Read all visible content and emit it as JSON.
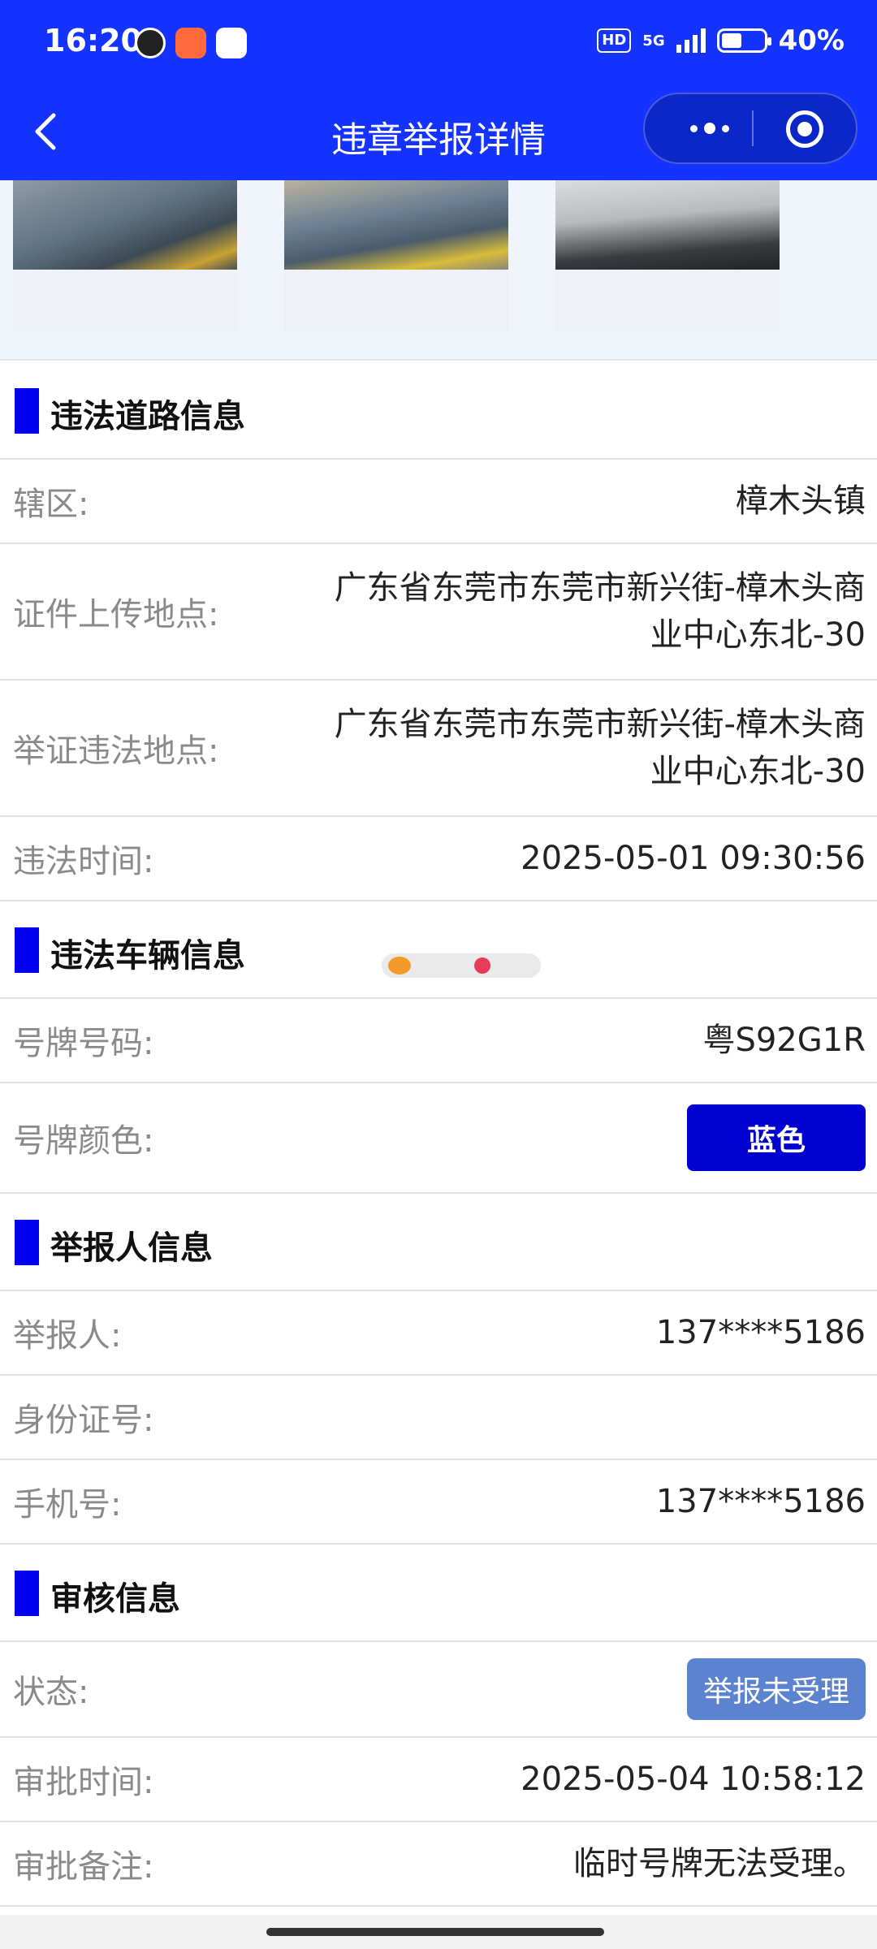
{
  "status_bar": {
    "time": "16:20",
    "hd": "HD",
    "network": "5G",
    "battery": "40%",
    "battery_level": 0.4
  },
  "navbar": {
    "title": "违章举报详情",
    "back_icon": "chevron-left-icon",
    "more_icon": "more-dots-icon",
    "target_icon": "target-icon"
  },
  "sections": {
    "road": {
      "title": "违法道路信息",
      "rows": {
        "district": {
          "label": "辖区:",
          "value": "樟木头镇"
        },
        "upload_location": {
          "label": "证件上传地点:",
          "value_line1": "广东省东莞市东莞市新兴街-樟木头商",
          "value_line2": "业中心东北-30"
        },
        "violation_location": {
          "label": "举证违法地点:",
          "value_line1": "广东省东莞市东莞市新兴街-樟木头商",
          "value_line2": "业中心东北-30"
        },
        "violation_time": {
          "label": "违法时间:",
          "value": "2025-05-01 09:30:56"
        }
      }
    },
    "vehicle": {
      "title": "违法车辆信息",
      "rows": {
        "plate_number": {
          "label": "号牌号码:",
          "value": "粤S92G1R"
        },
        "plate_color": {
          "label": "号牌颜色:",
          "value": "蓝色"
        }
      }
    },
    "reporter": {
      "title": "举报人信息",
      "rows": {
        "reporter": {
          "label": "举报人:",
          "value": "137****5186"
        },
        "id_number": {
          "label": "身份证号:",
          "value": ""
        },
        "phone": {
          "label": "手机号:",
          "value": "137****5186"
        }
      }
    },
    "review": {
      "title": "审核信息",
      "rows": {
        "status": {
          "label": "状态:",
          "value": "举报未受理"
        },
        "review_time": {
          "label": "审批时间:",
          "value": "2025-05-04 10:58:12"
        },
        "review_note": {
          "label": "审批备注:",
          "value": "临时号牌无法受理。"
        }
      }
    }
  },
  "colors": {
    "header": "#1433ff",
    "section_marker": "#0000ee",
    "plate_badge": "#0000d0",
    "status_badge": "#5b83cf"
  }
}
